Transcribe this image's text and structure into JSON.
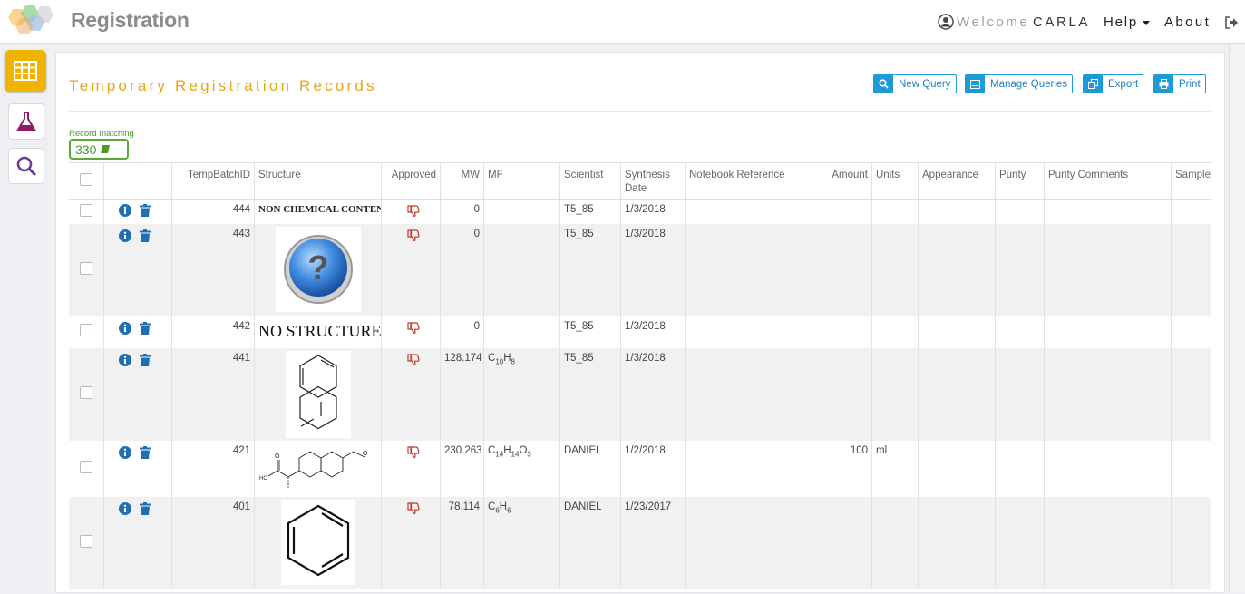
{
  "header": {
    "app_title": "Registration",
    "welcome": "Welcome",
    "username": "CARLA",
    "help": "Help",
    "about": "About"
  },
  "sidebar": {
    "items": [
      {
        "name": "grid-icon",
        "active": true
      },
      {
        "name": "flask-icon",
        "active": false
      },
      {
        "name": "search-icon",
        "active": false
      }
    ]
  },
  "page": {
    "title": "Temporary Registration Records",
    "record_matching_label": "Record matching",
    "record_count": "330"
  },
  "toolbar": {
    "new_query": "New Query",
    "manage_queries": "Manage Queries",
    "export": "Export",
    "print": "Print"
  },
  "columns": [
    "TempBatchID",
    "Structure",
    "Approved",
    "MW",
    "MF",
    "Scientist",
    "Synthesis Date",
    "Notebook Reference",
    "Amount",
    "Units",
    "Appearance",
    "Purity",
    "Purity Comments",
    "Sample I"
  ],
  "rows": [
    {
      "id": "444",
      "structure_text": "NON CHEMICAL CONTENT",
      "mw": "0",
      "mf": "",
      "scientist": "T5_85",
      "date": "1/3/2018",
      "amount": "",
      "units": ""
    },
    {
      "id": "443",
      "structure_text": "",
      "mw": "0",
      "mf": "",
      "scientist": "T5_85",
      "date": "1/3/2018",
      "amount": "",
      "units": ""
    },
    {
      "id": "442",
      "structure_text": "NO STRUCTURE",
      "mw": "0",
      "mf": "",
      "scientist": "T5_85",
      "date": "1/3/2018",
      "amount": "",
      "units": ""
    },
    {
      "id": "441",
      "structure_text": "",
      "mw": "128.174",
      "mf": "C10H8",
      "scientist": "T5_85",
      "date": "1/3/2018",
      "amount": "",
      "units": ""
    },
    {
      "id": "421",
      "structure_text": "",
      "mw": "230.263",
      "mf": "C14H14O3",
      "scientist": "DANIEL",
      "date": "1/2/2018",
      "amount": "100",
      "units": "ml"
    },
    {
      "id": "401",
      "structure_text": "",
      "mw": "78.114",
      "mf": "C6H6",
      "scientist": "DANIEL",
      "date": "1/23/2017",
      "amount": "",
      "units": ""
    }
  ],
  "colors": {
    "accent_gold": "#f0b400",
    "title_gold": "#e8a613",
    "button_blue": "#1e9ad6",
    "record_green": "#4a9a2e",
    "thumb_red": "#c0392b"
  }
}
